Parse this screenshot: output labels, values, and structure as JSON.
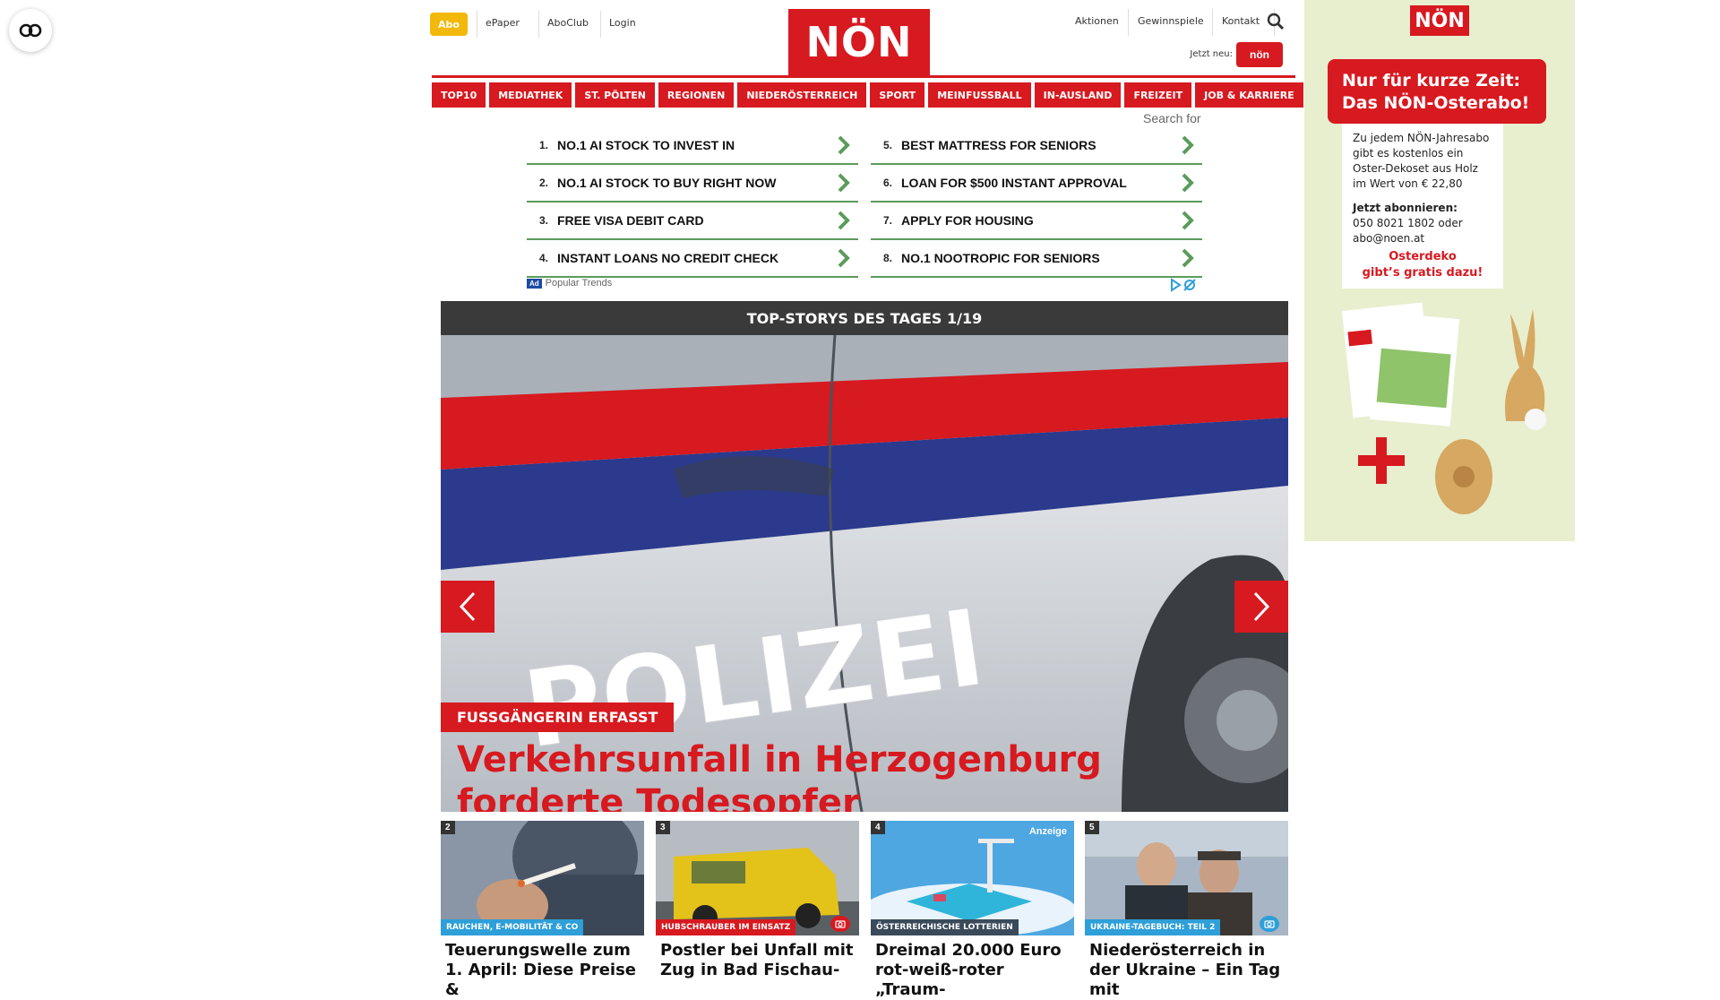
{
  "header": {
    "abo_label": "Abo",
    "links_left": [
      "ePaper",
      "AboClub",
      "Login"
    ],
    "logo": "NÖN",
    "links_right": [
      "Aktionen",
      "Gewinnspiele",
      "Kontakt"
    ],
    "jetzt_neu": "Jetzt neu:",
    "badge_text": "nön"
  },
  "nav": {
    "items": [
      "TOP10",
      "MEDIATHEK",
      "ST. PÖLTEN",
      "REGIONEN",
      "NIEDERÖSTERREICH",
      "SPORT",
      "MEINFUSSBALL",
      "IN-AUSLAND",
      "FREIZEIT",
      "JOB & KARRIERE"
    ]
  },
  "sponsored": {
    "search_label": "Search for",
    "left": [
      {
        "num": "1.",
        "text": "NO.1 AI STOCK TO INVEST IN"
      },
      {
        "num": "2.",
        "text": "NO.1 AI STOCK TO BUY RIGHT NOW"
      },
      {
        "num": "3.",
        "text": "FREE VISA DEBIT CARD"
      },
      {
        "num": "4.",
        "text": "INSTANT LOANS NO CREDIT CHECK"
      }
    ],
    "right": [
      {
        "num": "5.",
        "text": "BEST MATTRESS FOR SENIORS"
      },
      {
        "num": "6.",
        "text": "LOAN FOR $500 INSTANT APPROVAL"
      },
      {
        "num": "7.",
        "text": "APPLY FOR HOUSING"
      },
      {
        "num": "8.",
        "text": "NO.1 NOOTROPIC FOR SENIORS"
      }
    ],
    "ad_badge": "Ad",
    "footer": "Popular Trends"
  },
  "slider": {
    "heading": "TOP-STORYS DES TAGES 1/19",
    "car_text": "POLIZEI",
    "kicker": "FUSSGÄNGERIN ERFASST",
    "title": "Verkehrsunfall in Herzogenburg forderte Todesopfer"
  },
  "cards": [
    {
      "num": "2",
      "tag": "RAUCHEN, E-MOBILITÄT & CO",
      "title": "Teuerungswelle zum 1. April: Diese Preise &"
    },
    {
      "num": "3",
      "tag": "HUBSCHRAUBER IM EINSATZ",
      "title": "Postler bei Unfall mit Zug in Bad Fischau-"
    },
    {
      "num": "4",
      "tag": "ÖSTERREICHISCHE LOTTERIEN",
      "anzeige": "Anzeige",
      "title": "Dreimal 20.000 Euro rot-weiß-roter „Traum-"
    },
    {
      "num": "5",
      "tag": "UKRAINE-TAGEBUCH: TEIL 2",
      "title": "Niederösterreich in der Ukraine – Ein Tag mit"
    }
  ],
  "side_ad": {
    "logo": "NÖN",
    "headline_1": "Nur für kurze Zeit:",
    "headline_2": "Das NÖN-Osterabo!",
    "body_1": "Zu jedem NÖN-Jahresabo",
    "body_2": "gibt es kostenlos ein",
    "body_3": "Oster-Dekoset aus Holz",
    "body_4": "im Wert von € 22,80",
    "cta": "Jetzt abonnieren:",
    "phone": "050 8021 1802 oder",
    "email": "abo@noen.at",
    "promo_1": "Osterdeko",
    "promo_2": "gibt’s gratis dazu!"
  },
  "colors": {
    "brand_red": "#d71920",
    "abo_yellow": "#f2b90a",
    "slider_header": "#3a3a3a",
    "ad_green": "#5b9b5b",
    "ad_bg": "#e8efcf"
  }
}
